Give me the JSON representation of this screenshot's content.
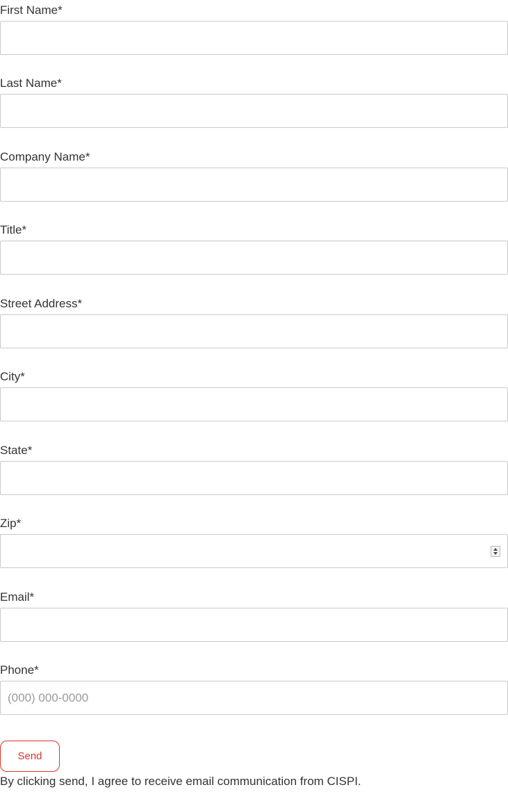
{
  "form": {
    "fields": [
      {
        "label": "First Name*",
        "value": "",
        "placeholder": ""
      },
      {
        "label": "Last Name*",
        "value": "",
        "placeholder": ""
      },
      {
        "label": "Company Name*",
        "value": "",
        "placeholder": ""
      },
      {
        "label": "Title*",
        "value": "",
        "placeholder": ""
      },
      {
        "label": "Street Address*",
        "value": "",
        "placeholder": ""
      },
      {
        "label": "City*",
        "value": "",
        "placeholder": ""
      },
      {
        "label": "State*",
        "value": "",
        "placeholder": ""
      },
      {
        "label": "Zip*",
        "value": "",
        "placeholder": "",
        "icon": "number-spinner-icon"
      },
      {
        "label": "Email*",
        "value": "",
        "placeholder": ""
      },
      {
        "label": "Phone*",
        "value": "",
        "placeholder": "(000) 000-0000"
      }
    ],
    "submit_label": "Send",
    "consent_text": "By clicking send, I agree to receive email communication from CISPI."
  },
  "colors": {
    "accent": "#d9342b",
    "text": "#333333",
    "border": "#c9c9c9",
    "placeholder": "#9a9a9a"
  }
}
